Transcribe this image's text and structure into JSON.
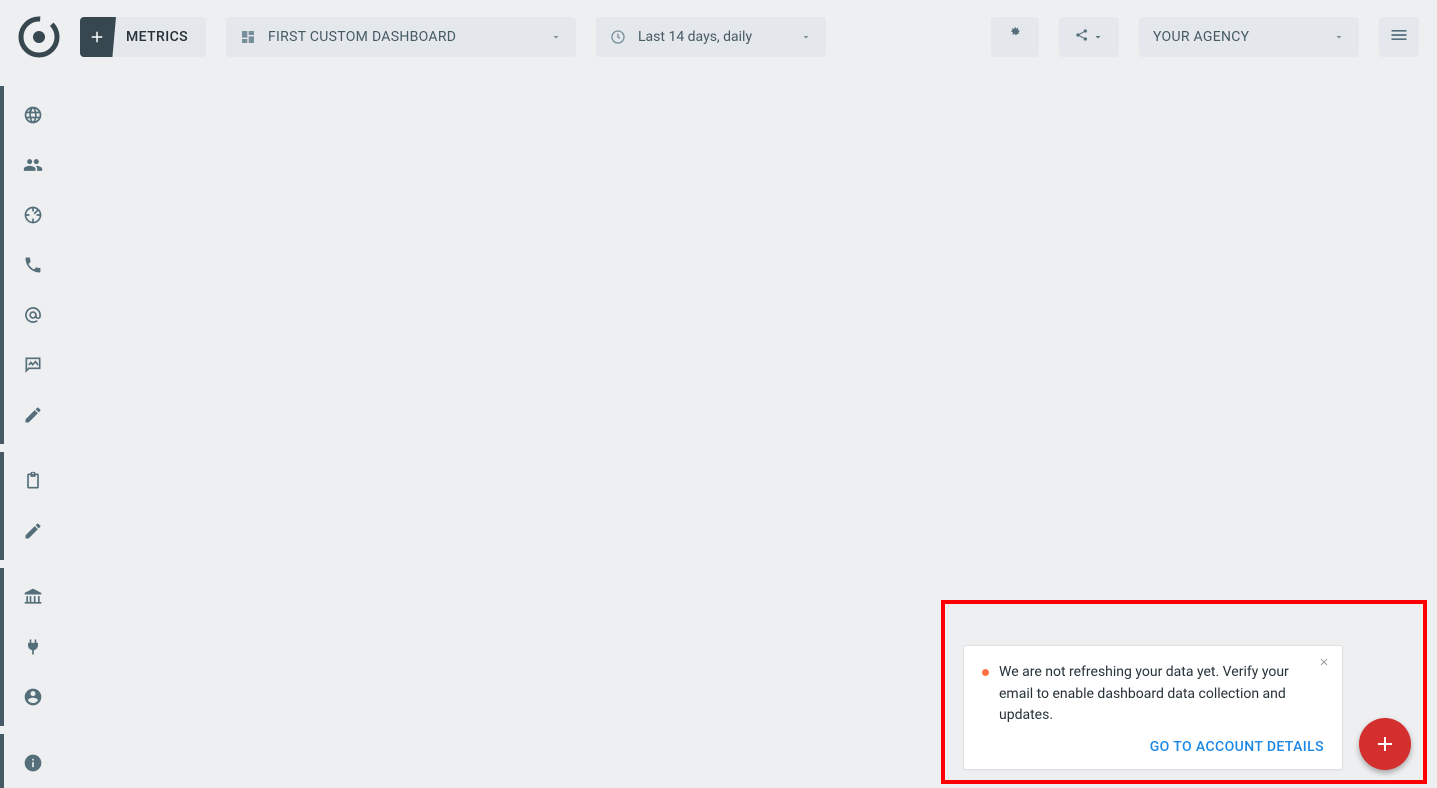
{
  "header": {
    "metrics_label": "METRICS",
    "dashboard_selector": "FIRST CUSTOM DASHBOARD",
    "date_selector": "Last 14 days, daily",
    "agency_selector": "YOUR AGENCY"
  },
  "sidebar": {
    "items": [
      {
        "name": "globe-icon"
      },
      {
        "name": "group-icon"
      },
      {
        "name": "target-icon"
      },
      {
        "name": "phone-icon"
      },
      {
        "name": "at-icon"
      },
      {
        "name": "image-message-icon"
      },
      {
        "name": "edit-icon"
      },
      {
        "name": "clipboard-icon"
      },
      {
        "name": "edit-icon-2"
      },
      {
        "name": "bank-icon"
      },
      {
        "name": "plug-icon"
      },
      {
        "name": "account-icon"
      },
      {
        "name": "info-icon"
      }
    ]
  },
  "notification": {
    "message": "We are not refreshing your data yet. Verify your email to enable dashboard data collection and updates.",
    "action": "GO TO ACCOUNT DETAILS"
  }
}
